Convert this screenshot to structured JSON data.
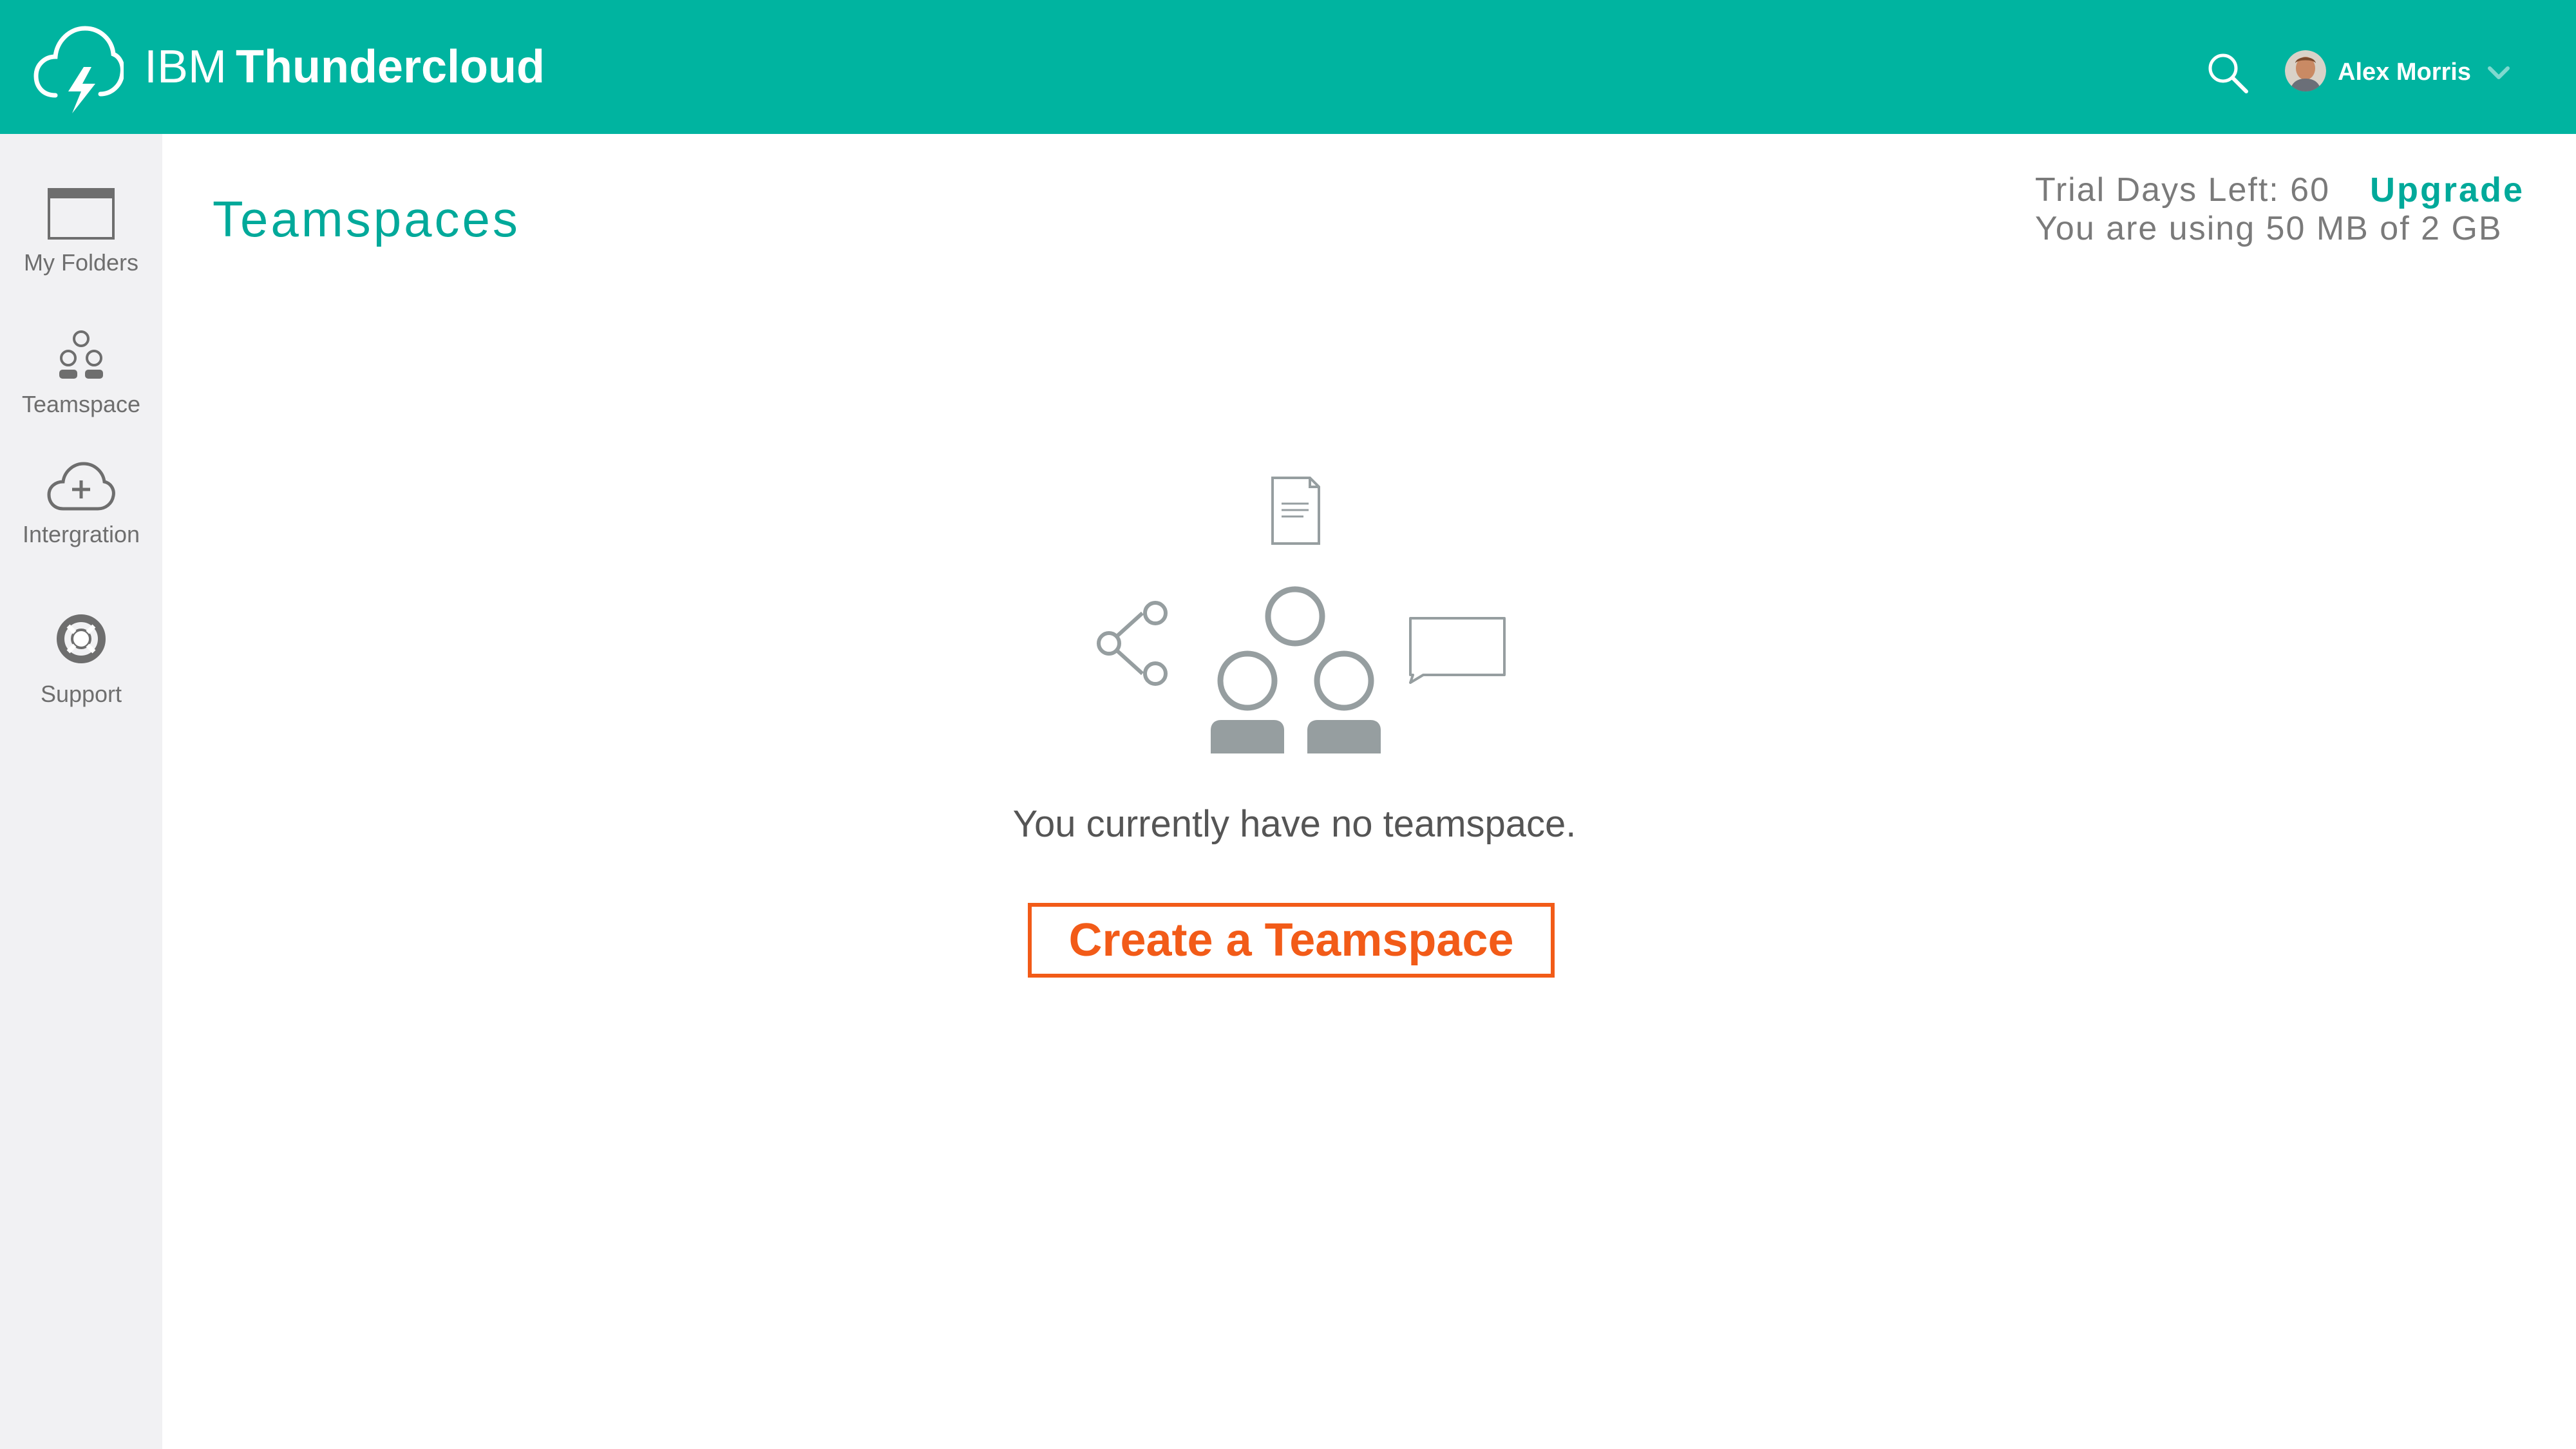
{
  "header": {
    "brand_prefix": "IBM",
    "brand_name": "Thundercloud",
    "user_name": "Alex Morris",
    "icons": [
      "cloud-lightning-icon",
      "search-icon",
      "avatar",
      "chevron-down-icon"
    ]
  },
  "sidebar": {
    "items": [
      {
        "label": "My Folders",
        "icon": "folder-icon"
      },
      {
        "label": "Teamspace",
        "icon": "team-icon"
      },
      {
        "label": "Intergration",
        "icon": "cloud-plus-icon"
      },
      {
        "label": "Support",
        "icon": "lifebuoy-icon"
      }
    ]
  },
  "main": {
    "title": "Teamspaces",
    "trial_days": "Trial Days Left: 60",
    "upgrade_label": "Upgrade",
    "storage_usage": "You are using 50 MB of 2 GB",
    "empty_message": "You currently have no teamspace.",
    "create_button_label": "Create a Teamspace"
  },
  "colors": {
    "header_bg": "#00b4a0",
    "accent_teal": "#00a99a",
    "accent_orange": "#f25b18",
    "sidebar_bg": "#f1f1f3",
    "icon_gray": "#969ea0"
  }
}
